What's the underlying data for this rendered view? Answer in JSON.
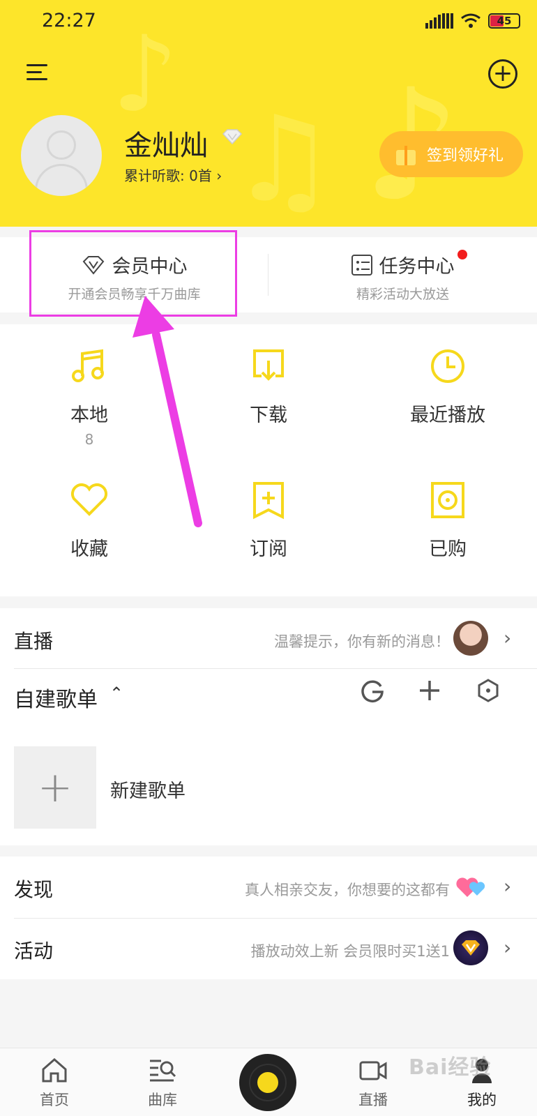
{
  "status_bar": {
    "time": "22:27",
    "battery": "45"
  },
  "profile": {
    "username": "金灿灿",
    "listen_count": "累计听歌: 0首",
    "sign_button": "签到领好礼"
  },
  "entry": {
    "vip": {
      "title": "会员中心",
      "subtitle": "开通会员畅享千万曲库"
    },
    "task": {
      "title": "任务中心",
      "subtitle": "精彩活动大放送"
    }
  },
  "grid": [
    {
      "label": "本地",
      "count": "8",
      "icon": "music-note-icon"
    },
    {
      "label": "下载",
      "icon": "download-icon"
    },
    {
      "label": "最近播放",
      "icon": "clock-icon"
    },
    {
      "label": "收藏",
      "icon": "heart-icon"
    },
    {
      "label": "订阅",
      "icon": "bookmark-plus-icon"
    },
    {
      "label": "已购",
      "icon": "purchased-disc-icon"
    }
  ],
  "live": {
    "label": "直播",
    "hint": "温馨提示，你有新的消息！"
  },
  "playlists": {
    "title": "自建歌单",
    "new_label": "新建歌单"
  },
  "discover": {
    "label": "发现",
    "hint": "真人相亲交友，你想要的这都有"
  },
  "activity": {
    "label": "活动",
    "hint": "播放动效上新 会员限时买1送1"
  },
  "nav": {
    "home": "首页",
    "library": "曲库",
    "live": "直播",
    "mine": "我的"
  },
  "watermark": "Bai经验",
  "colors": {
    "brand_yellow": "#fde52a",
    "accent_orange": "#ffbd2e",
    "highlight_magenta": "#ec3de4",
    "icon_yellow": "#f6d81c"
  }
}
